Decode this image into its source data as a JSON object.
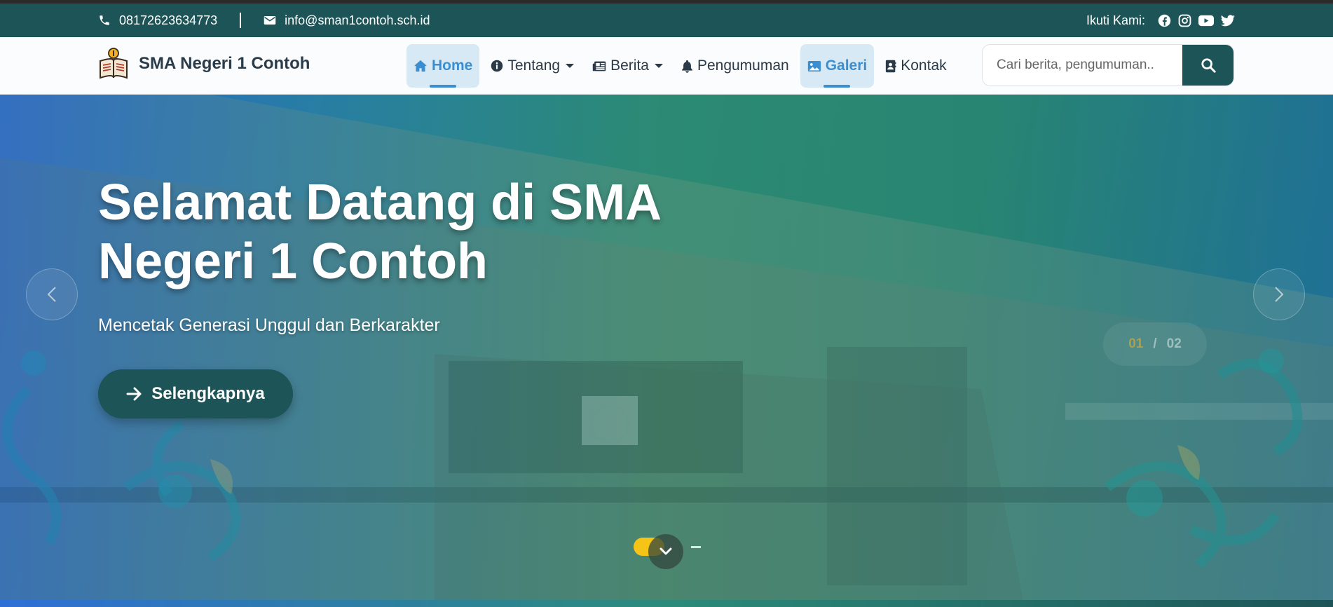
{
  "topbar": {
    "phone": "08172623634773",
    "email": "info@sman1contoh.sch.id",
    "follow_label": "Ikuti Kami:",
    "socials": [
      "facebook-icon",
      "instagram-icon",
      "youtube-icon",
      "twitter-icon"
    ]
  },
  "navbar": {
    "brand": "SMA Negeri 1 Contoh",
    "items": [
      {
        "label": "Home",
        "icon": "home-icon",
        "active": true
      },
      {
        "label": "Tentang",
        "icon": "info-icon",
        "dropdown": true
      },
      {
        "label": "Berita",
        "icon": "newspaper-icon",
        "dropdown": true
      },
      {
        "label": "Pengumuman",
        "icon": "bell-icon"
      },
      {
        "label": "Galeri",
        "icon": "image-icon",
        "active": true
      },
      {
        "label": "Kontak",
        "icon": "contact-book-icon"
      }
    ],
    "search_placeholder": "Cari berita, pengumuman.."
  },
  "hero": {
    "title": "Selamat Datang di SMA Negeri 1 Contoh",
    "subtitle": "Mencetak Generasi Unggul dan Berkarakter",
    "button_label": "Selengkapnya",
    "counter_current": "01",
    "counter_sep": "/",
    "counter_total": "02"
  },
  "colors": {
    "brand_dark": "#1d5457",
    "accent_blue": "#3b8fd1",
    "accent_yellow": "#f6c317"
  }
}
